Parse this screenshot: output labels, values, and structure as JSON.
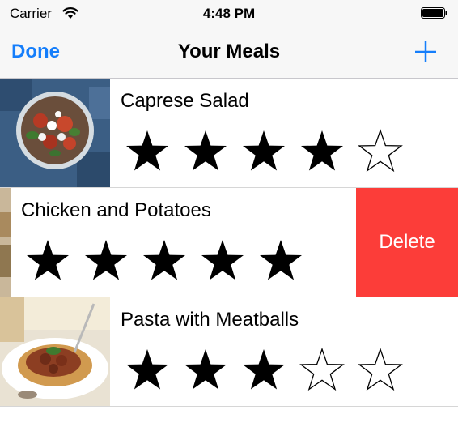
{
  "status_bar": {
    "carrier": "Carrier",
    "time": "4:48 PM",
    "icons": [
      "wifi-icon",
      "battery-icon"
    ]
  },
  "nav": {
    "done_label": "Done",
    "title": "Your Meals",
    "add_icon": "plus-icon"
  },
  "meals": [
    {
      "name": "Caprese Salad",
      "rating": 4,
      "max_rating": 5,
      "photo": "caprese-salad-photo"
    },
    {
      "name": "Chicken and Potatoes",
      "rating": 5,
      "max_rating": 5,
      "photo": "chicken-and-potatoes-photo",
      "swiped_action": "Delete"
    },
    {
      "name": "Pasta with Meatballs",
      "rating": 3,
      "max_rating": 5,
      "photo": "pasta-with-meatballs-photo"
    }
  ],
  "colors": {
    "tint": "#157efb",
    "delete": "#fc3d39",
    "bar_background": "#f7f7f7"
  }
}
